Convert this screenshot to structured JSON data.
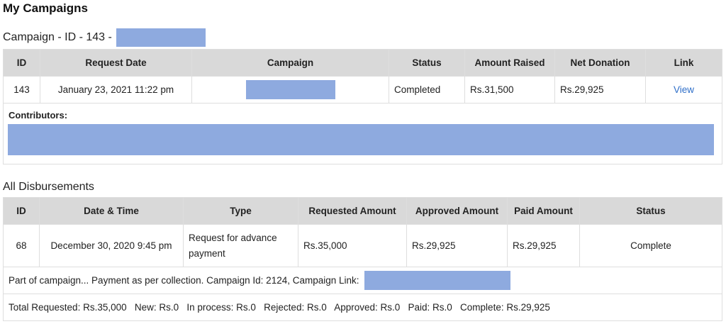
{
  "page_title": "My Campaigns",
  "campaign": {
    "heading": "Campaign - ID - 143 -",
    "columns": [
      "ID",
      "Request Date",
      "Campaign",
      "Status",
      "Amount Raised",
      "Net Donation",
      "Link"
    ],
    "row": {
      "id": "143",
      "request_date": "January 23, 2021 11:22 pm",
      "status": "Completed",
      "amount_raised": "Rs.31,500",
      "net_donation": "Rs.29,925",
      "link": "View"
    },
    "contributors_label": "Contributors:"
  },
  "disbursements": {
    "heading": "All Disbursements",
    "columns": [
      "ID",
      "Date & Time",
      "Type",
      "Requested Amount",
      "Approved Amount",
      "Paid Amount",
      "Status"
    ],
    "row": {
      "id": "68",
      "date_time": "December 30, 2020 9:45 pm",
      "type": "Request for advance payment",
      "requested_amount": "Rs.35,000",
      "approved_amount": "Rs.29,925",
      "paid_amount": "Rs.29,925",
      "status": "Complete"
    },
    "note": "Part of campaign... Payment as per collection. Campaign Id: 2124, Campaign Link:",
    "totals": "Total Requested: Rs.35,000   New: Rs.0   In process: Rs.0   Rejected: Rs.0   Approved: Rs.0   Paid: Rs.0   Complete: Rs.29,925"
  },
  "colors": {
    "header_bg": "#d9d9d9",
    "redaction": "#8eaadf",
    "link": "#2f6fc9"
  }
}
